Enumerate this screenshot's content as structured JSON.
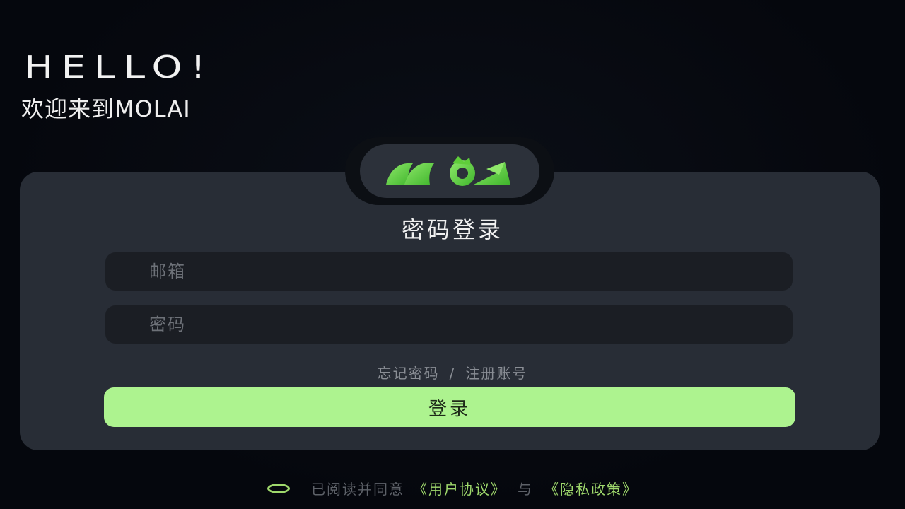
{
  "header": {
    "greeting": "HELLO!",
    "welcome": "欢迎来到MOLAI"
  },
  "logo": {
    "icon": "molai-logo-icon",
    "brand_color": "#5fce3a"
  },
  "card": {
    "title": "密码登录",
    "email_placeholder": "邮箱",
    "password_placeholder": "密码",
    "forgot_password": "忘记密码",
    "separator": "/",
    "register": "注册账号",
    "login_button": "登录"
  },
  "agreement": {
    "checkbox_icon": "radio-circle-icon",
    "prefix": "已阅读并同意",
    "user_agreement": "《用户协议》",
    "conjunction": "与",
    "privacy_policy": "《隐私政策》",
    "accent_color": "#9fd86c"
  },
  "colors": {
    "background": "#05070d",
    "card": "#282d36",
    "input": "#1b1e24",
    "button": "#adf38f"
  }
}
